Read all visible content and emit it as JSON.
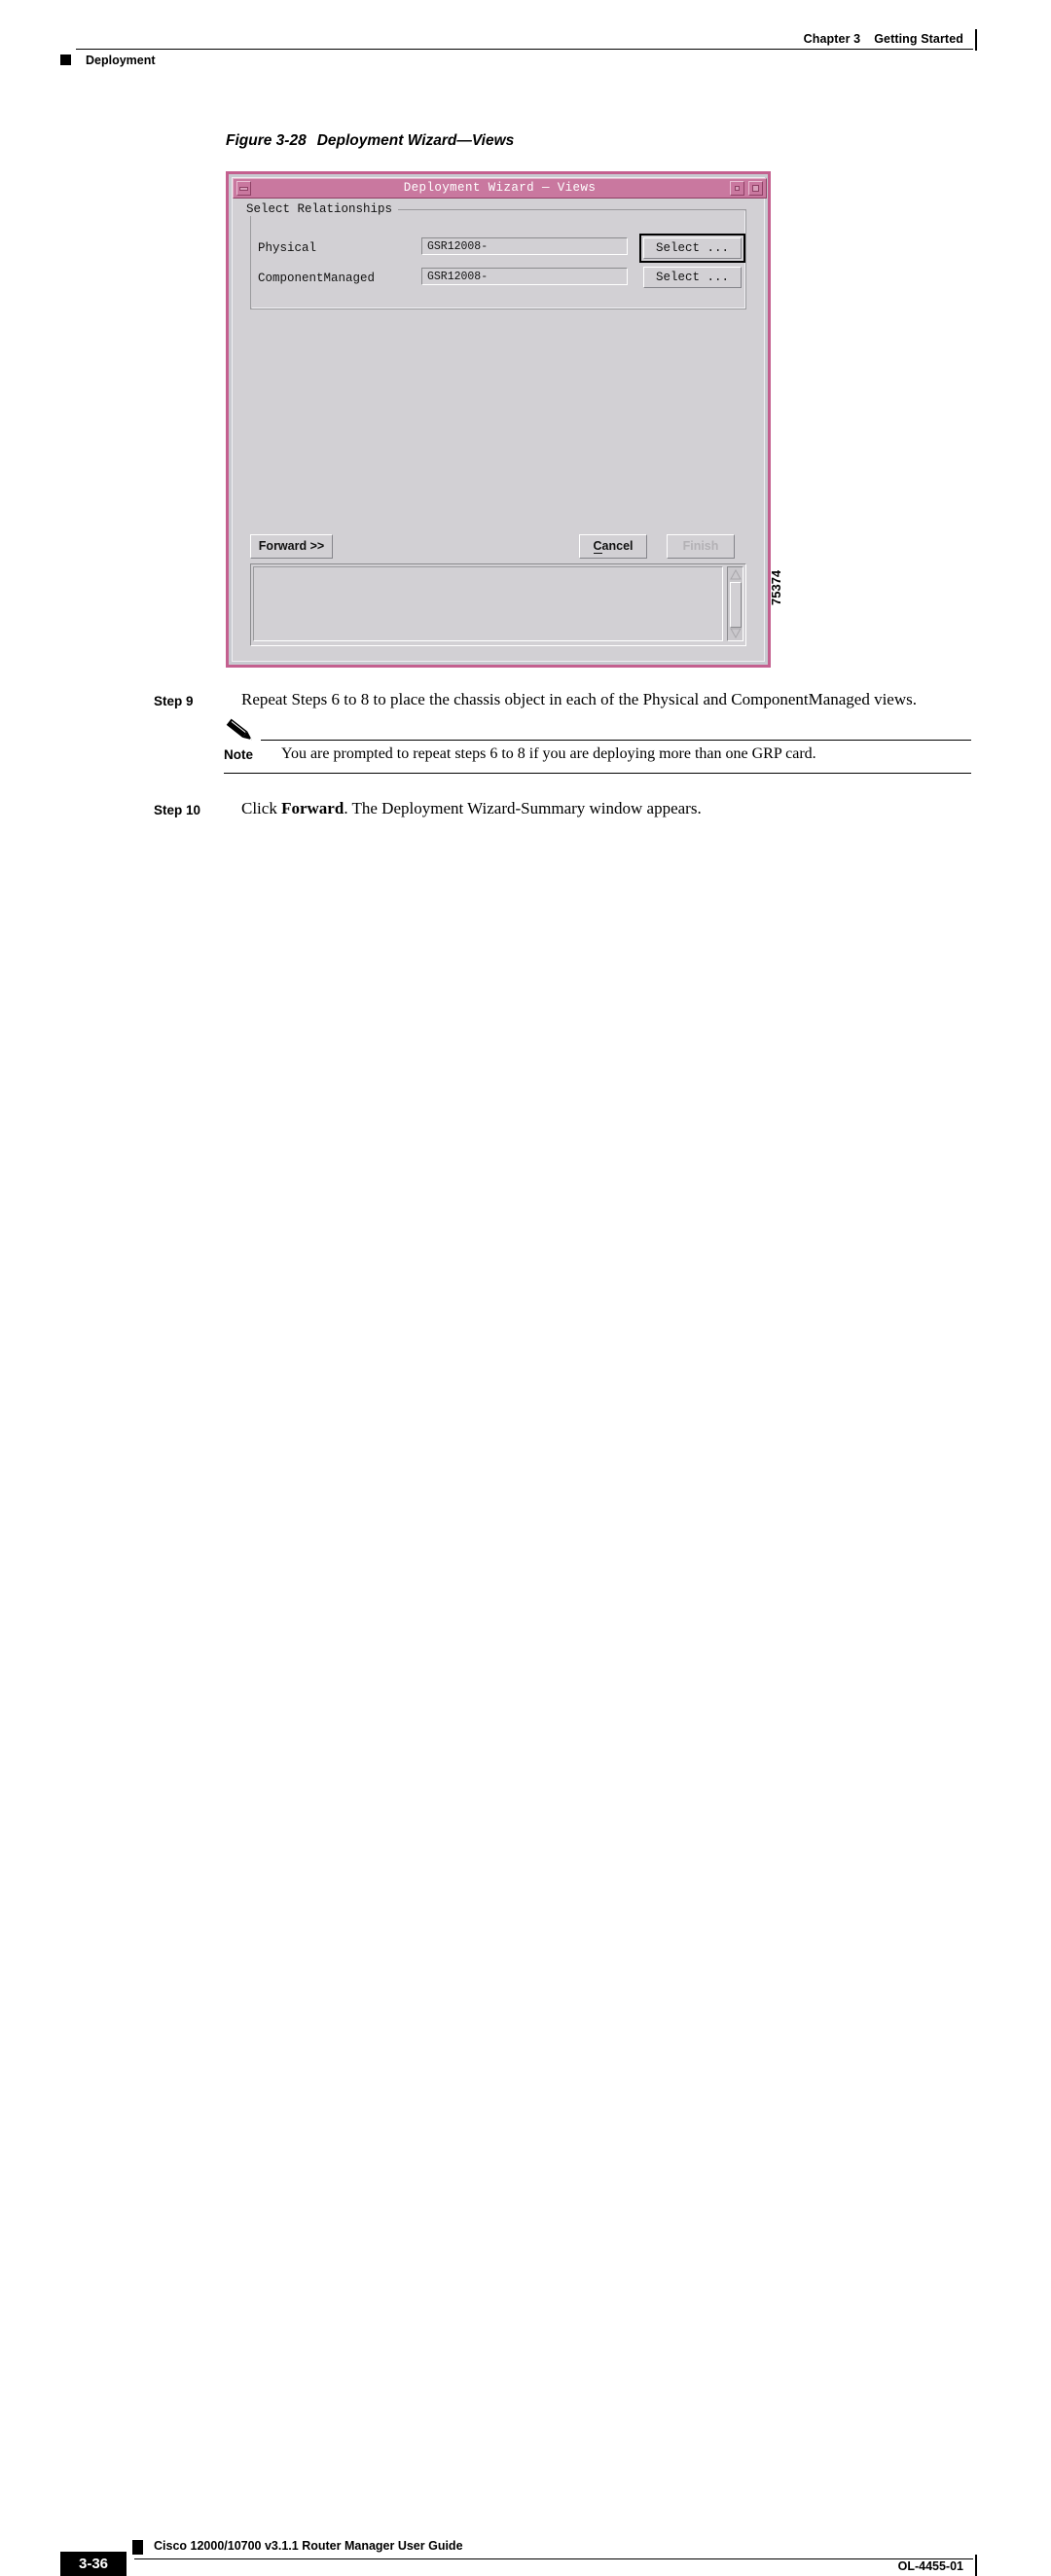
{
  "header": {
    "chapter": "Chapter 3",
    "chapter_title": "Getting Started",
    "section": "Deployment"
  },
  "figure": {
    "number": "Figure 3-28",
    "title": "Deployment Wizard—Views",
    "graphic_id": "75374"
  },
  "dialog": {
    "title": "Deployment Wizard — Views",
    "titlebar_color": "#c9789f",
    "frame_color": "#c4608f",
    "body_color": "#d2d0d4",
    "minimize_label": "minimize",
    "maximize_label": "maximize",
    "close_label": "close",
    "group": {
      "legend": "Select Relationships",
      "rows": [
        {
          "label": "Physical",
          "value": "GSR12008-",
          "button": "Select ...",
          "default": true
        },
        {
          "label": "ComponentManaged",
          "value": "GSR12008-",
          "button": "Select ...",
          "default": false
        }
      ]
    },
    "buttons": {
      "forward": "Forward >>",
      "cancel_accel": "C",
      "cancel_rest": "ancel",
      "finish": "Finish",
      "finish_disabled": true
    },
    "output_area": {
      "text": "",
      "scrollbar": "vertical"
    }
  },
  "steps": [
    {
      "label": "Step 9",
      "text": "Repeat Steps 6 to 8 to place the chassis object in each of the Physical and ComponentManaged views."
    }
  ],
  "note": {
    "icon": "pencil-icon",
    "label": "Note",
    "text": "You are prompted to repeat steps 6 to 8 if you are deploying more than one GRP card."
  },
  "step10": {
    "label": "Step 10",
    "prefix": "Click ",
    "bold": "Forward",
    "suffix": ". The Deployment Wizard-Summary window appears."
  },
  "footer": {
    "page_number": "3-36",
    "book_title": "Cisco 12000/10700 v3.1.1 Router Manager User Guide",
    "doc_id": "OL-4455-01"
  }
}
